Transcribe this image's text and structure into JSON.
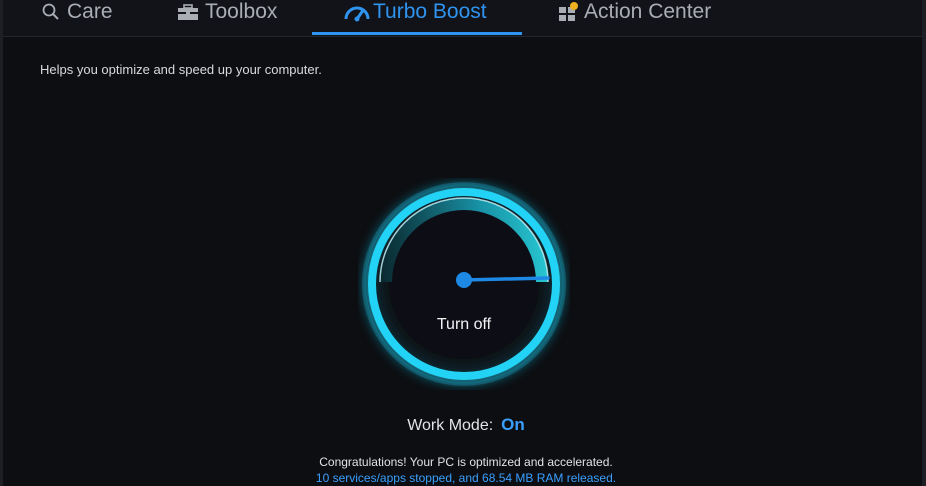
{
  "tabs": {
    "care": "Care",
    "toolbox": "Toolbox",
    "turbo_boost": "Turbo Boost",
    "action_center": "Action Center"
  },
  "active_tab": "Turbo Boost",
  "page": {
    "subtitle": "Helps you optimize and speed up your computer."
  },
  "gauge": {
    "button_label": "Turn off"
  },
  "work_mode": {
    "label": "Work Mode:",
    "value": "On"
  },
  "status": {
    "message": "Congratulations! Your PC is optimized and accelerated.",
    "detail": "10 services/apps stopped, and 68.54 MB RAM released."
  },
  "colors": {
    "accent": "#2f93f0",
    "gauge_cyan": "#22d3f5",
    "background": "#0d0e11",
    "action_center_badge": "#f0b020"
  },
  "icons": [
    "search-icon",
    "toolbox-icon",
    "speedometer-icon",
    "action-center-icon"
  ]
}
